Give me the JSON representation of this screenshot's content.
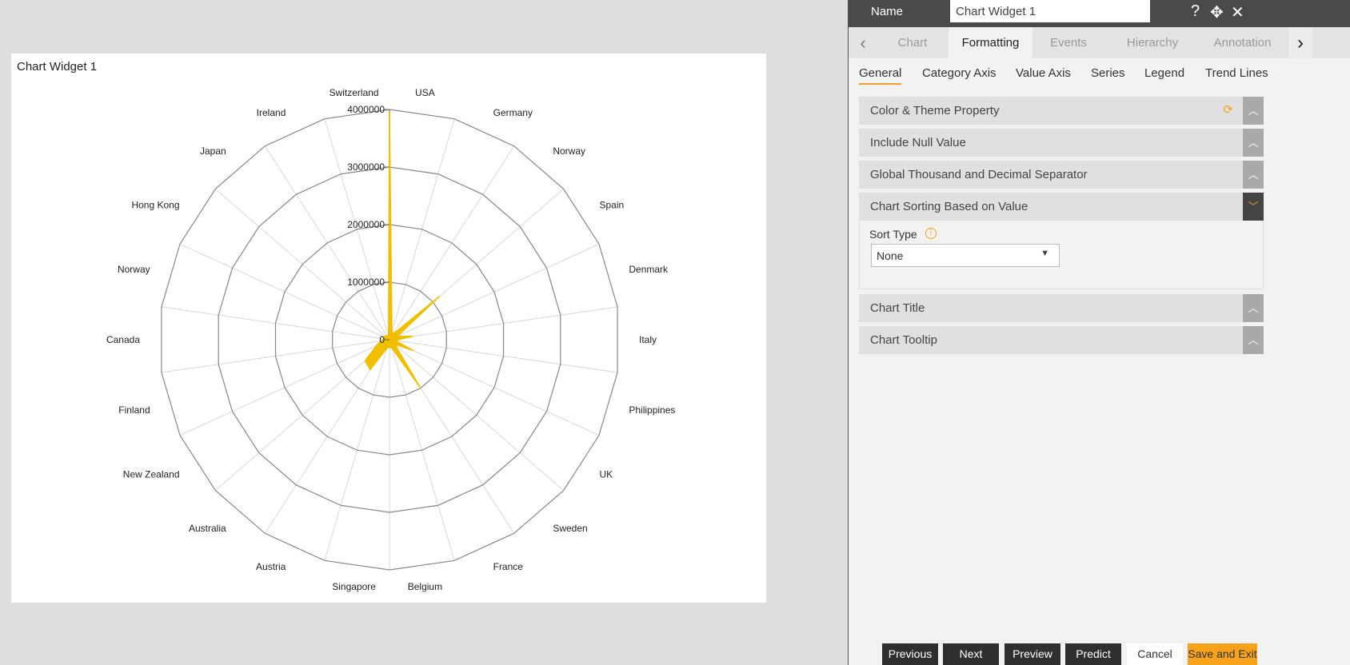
{
  "widget": {
    "title": "Chart Widget 1"
  },
  "chart_data": {
    "type": "radar",
    "categories": [
      "USA",
      "Germany",
      "Norway",
      "Spain",
      "Denmark",
      "Italy",
      "Philippines",
      "UK",
      "Sweden",
      "France",
      "Belgium",
      "Singapore",
      "Austria",
      "Australia",
      "New Zealand",
      "Finland",
      "Canada",
      "Norway",
      "Hong Kong",
      "Japan",
      "Ireland",
      "Switzerland"
    ],
    "values": [
      3950000,
      150000,
      120000,
      1150000,
      150000,
      400000,
      100000,
      450000,
      120000,
      1000000,
      150000,
      130000,
      150000,
      620000,
      560000,
      250000,
      150000,
      100000,
      100000,
      100000,
      80000,
      60000
    ],
    "ylim": [
      0,
      4000000
    ],
    "ticks": [
      "0",
      "1000000",
      "2000000",
      "3000000",
      "4000000"
    ],
    "series_color": "#f0c000",
    "grid": true
  },
  "panel": {
    "name_label": "Name",
    "name_value": "Chart Widget 1",
    "icons": [
      "help-icon",
      "move-icon",
      "close-icon"
    ],
    "tabs": [
      "Chart",
      "Formatting",
      "Events",
      "Hierarchy",
      "Annotation"
    ],
    "subtabs": [
      "General",
      "Category Axis",
      "Value Axis",
      "Series",
      "Legend",
      "Trend Lines"
    ],
    "sections": [
      "Color & Theme Property",
      "Include Null Value",
      "Global Thousand and Decimal Separator",
      "Chart Sorting Based on Value",
      "Chart Title",
      "Chart Tooltip"
    ],
    "sort_type_label": "Sort Type",
    "sort_type_value": "None",
    "buttons": [
      "Previous",
      "Next",
      "Preview",
      "Predict",
      "Cancel",
      "Save and Exit"
    ],
    "accent": "#f7a21b"
  }
}
